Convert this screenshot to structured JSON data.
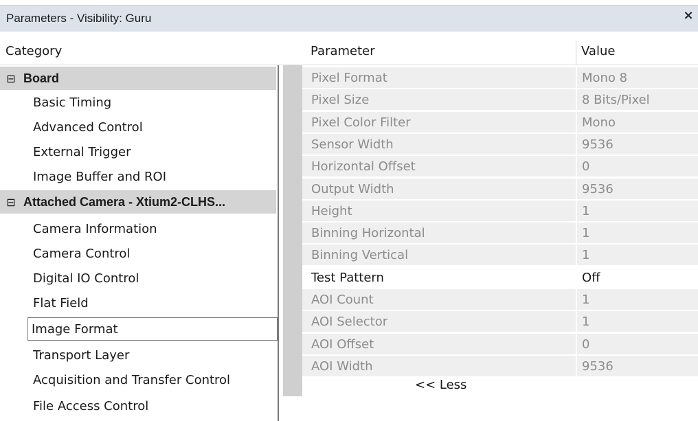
{
  "window": {
    "title": "Parameters - Visibility: Guru",
    "close_glyph": "×"
  },
  "headers": {
    "category": "Category",
    "parameter": "Parameter",
    "value": "Value"
  },
  "categories": [
    {
      "label": "Board",
      "type": "group",
      "expander": "⊟"
    },
    {
      "label": "Basic Timing",
      "type": "child"
    },
    {
      "label": "Advanced Control",
      "type": "child"
    },
    {
      "label": "External Trigger",
      "type": "child"
    },
    {
      "label": "Image Buffer and ROI",
      "type": "child"
    },
    {
      "label": "Attached Camera - Xtium2-CLHS...",
      "type": "group",
      "expander": "⊟"
    },
    {
      "label": "Camera Information",
      "type": "child"
    },
    {
      "label": "Camera Control",
      "type": "child"
    },
    {
      "label": "Digital IO Control",
      "type": "child"
    },
    {
      "label": "Flat Field",
      "type": "child"
    },
    {
      "label": "Image Format",
      "type": "child",
      "selected": true
    },
    {
      "label": "Transport Layer",
      "type": "child"
    },
    {
      "label": "Acquisition and Transfer Control",
      "type": "child"
    },
    {
      "label": "File Access Control",
      "type": "child"
    }
  ],
  "parameters": [
    {
      "name": "Pixel Format",
      "value": "Mono 8",
      "editable": false
    },
    {
      "name": "Pixel Size",
      "value": "8 Bits/Pixel",
      "editable": false
    },
    {
      "name": "Pixel Color Filter",
      "value": "Mono",
      "editable": false
    },
    {
      "name": "Sensor Width",
      "value": "9536",
      "editable": false
    },
    {
      "name": "Horizontal Offset",
      "value": "0",
      "editable": false
    },
    {
      "name": "Output Width",
      "value": "9536",
      "editable": false
    },
    {
      "name": "Height",
      "value": "1",
      "editable": false
    },
    {
      "name": "Binning Horizontal",
      "value": "1",
      "editable": false
    },
    {
      "name": "Binning Vertical",
      "value": "1",
      "editable": false
    },
    {
      "name": "Test Pattern",
      "value": "Off",
      "editable": true
    },
    {
      "name": "AOI Count",
      "value": "1",
      "editable": false
    },
    {
      "name": "AOI Selector",
      "value": "1",
      "editable": false
    },
    {
      "name": "AOI Offset",
      "value": "0",
      "editable": false
    },
    {
      "name": "AOI Width",
      "value": "9536",
      "editable": false
    }
  ],
  "less_button": "<< Less"
}
